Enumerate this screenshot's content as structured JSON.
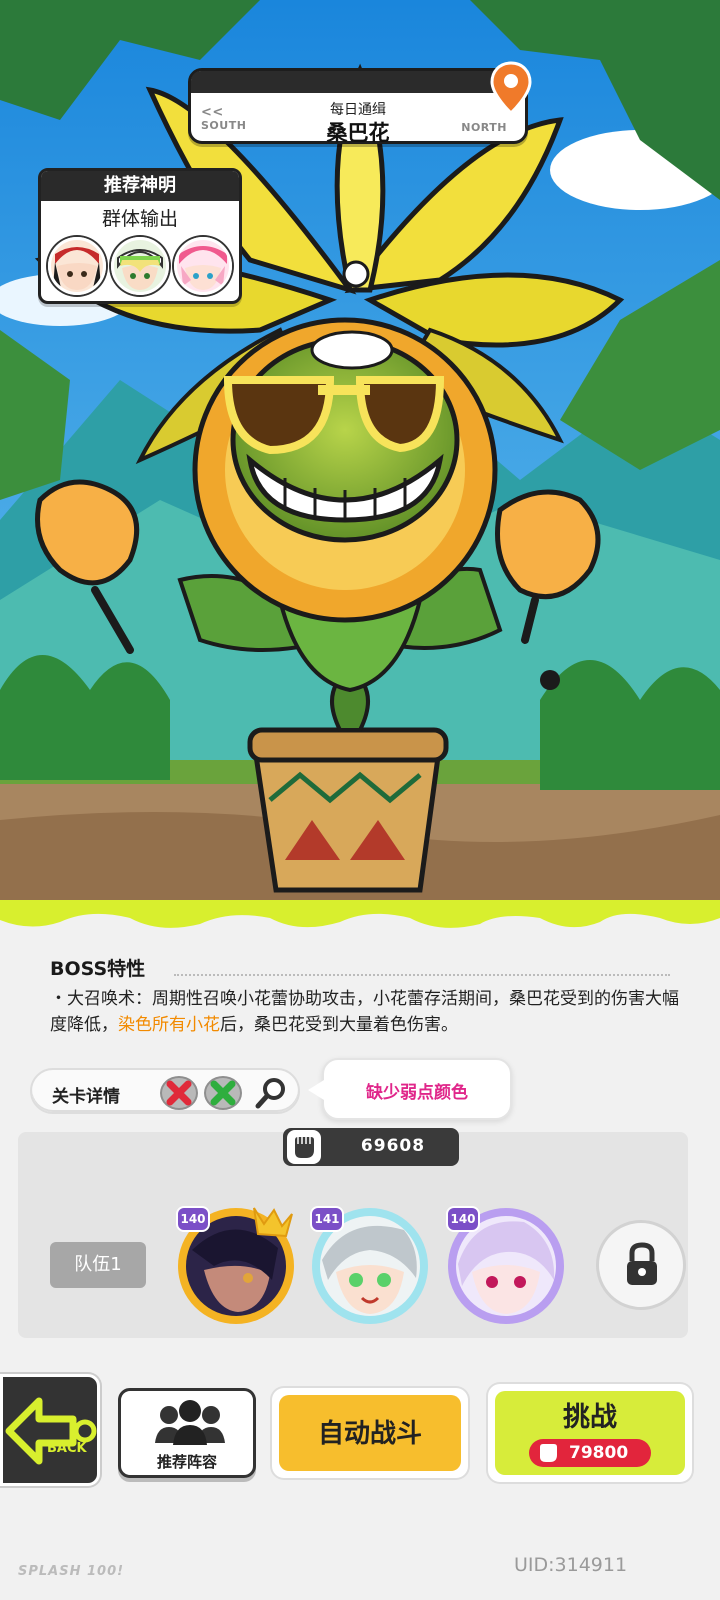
{
  "header": {
    "subtitle": "每日通缉",
    "title": "桑巴花",
    "left_direction": "SOUTH",
    "right_direction": "NORTH",
    "left_arrows": "<<"
  },
  "recommend": {
    "heading": "推荐神明",
    "role": "群体输出",
    "avatars": [
      "avatar-red-cap",
      "avatar-green-helmet",
      "avatar-pink-cap"
    ]
  },
  "boss": {
    "title": "BOSS特性",
    "desc_part1": "・大召唤术：周期性召唤小花蕾协助攻击，小花蕾存活期间，桑巴花受到的伤害大幅度降低，",
    "desc_highlight": "染色所有小花",
    "desc_part2": "后，桑巴花受到大量着色伤害。"
  },
  "stage": {
    "label": "关卡详情",
    "speech": "缺少弱点颜色"
  },
  "team": {
    "power": "69608",
    "label": "队伍1",
    "heroes": [
      {
        "level": "140",
        "name": "hero-dark-hair"
      },
      {
        "level": "141",
        "name": "hero-silver-hair"
      },
      {
        "level": "140",
        "name": "hero-lilac-hair"
      }
    ]
  },
  "buttons": {
    "back": "BACK",
    "recommend_lineup": "推荐阵容",
    "auto_battle": "自动战斗",
    "challenge": "挑战",
    "challenge_cost": "79800"
  },
  "footer": {
    "logo": "SPLASH 100!",
    "uid": "UID:314911"
  },
  "colors": {
    "highlight": "#f28a00",
    "speech_text": "#e0268a",
    "challenge_bg": "#d7ec3a",
    "auto_bg": "#f7be2d",
    "cost_bg": "#e2253c"
  }
}
